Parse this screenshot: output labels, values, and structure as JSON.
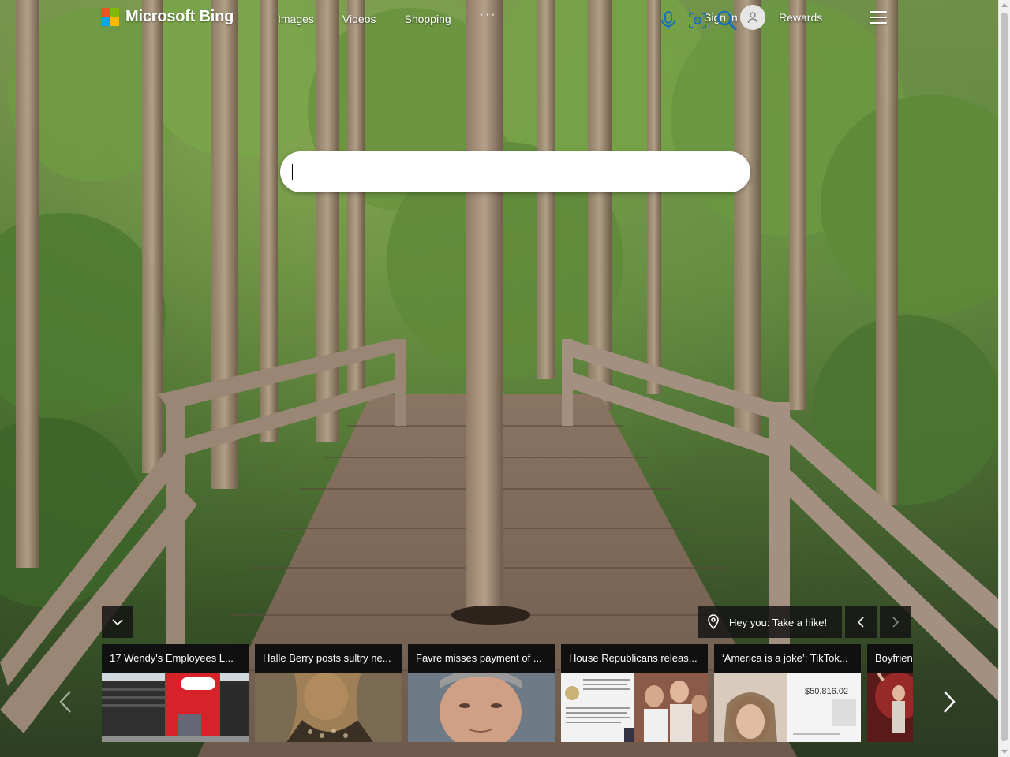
{
  "brand": {
    "name": "Microsoft Bing",
    "colors": [
      "#f25022",
      "#7fba00",
      "#00a4ef",
      "#ffb900"
    ]
  },
  "nav": {
    "items": [
      {
        "label": "Images"
      },
      {
        "label": "Videos"
      },
      {
        "label": "Shopping"
      }
    ],
    "more_label": "···"
  },
  "account": {
    "signin_label": "Sign in",
    "rewards_label": "Rewards"
  },
  "search": {
    "value": "",
    "placeholder": "",
    "accent": "#1a6ebd"
  },
  "image_of_day": {
    "caption": "Hey you: Take a hike!"
  },
  "news": [
    {
      "title": "17 Wendy's Employees L...",
      "thumb_icon": "wendys-storefront-thumb"
    },
    {
      "title": "Halle Berry posts sultry ne...",
      "thumb_icon": "portrait-thumb"
    },
    {
      "title": "Favre misses payment of ...",
      "thumb_icon": "face-closeup-thumb"
    },
    {
      "title": "House Republicans releas...",
      "thumb_icon": "document-crowd-thumb"
    },
    {
      "title": "‘America is a joke’: TikTok...",
      "thumb_icon": "tiktok-selfie-thumb"
    },
    {
      "title": "Boyfrien",
      "thumb_icon": "concert-thumb"
    }
  ],
  "tiktok_overlay": {
    "amount": "$50,816.02"
  }
}
